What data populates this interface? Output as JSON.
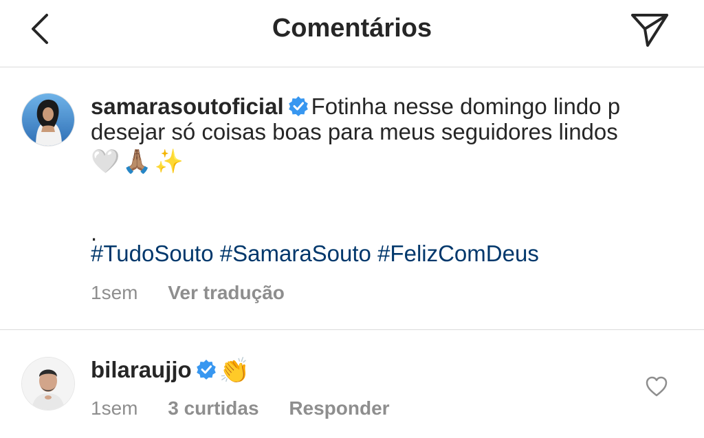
{
  "header": {
    "title": "Comentários",
    "back_icon": "chevron-left-icon",
    "send_icon": "paper-plane-icon"
  },
  "caption": {
    "username": "samarasoutoficial",
    "verified_icon": "verified-badge-icon",
    "text": "Fotinha nesse domingo lindo p desejar só coisas boas para meus seguidores lindos",
    "emojis": "🤍🙏🏽✨",
    "dot": ".",
    "hashtags": [
      "#TudoSouto",
      "#SamaraSouto",
      "#FelizComDeus"
    ],
    "time": "1sem",
    "translate_label": "Ver tradução"
  },
  "comment": {
    "username": "bilaraujjo",
    "verified_icon": "verified-badge-icon",
    "text": "👏",
    "time": "1sem",
    "likes": "3 curtidas",
    "reply_label": "Responder",
    "like_icon": "heart-outline-icon"
  },
  "colors": {
    "text": "#262626",
    "secondary": "#8e8e8e",
    "hashtag": "#00376b",
    "verified": "#3897f0",
    "divider": "#dbdbdb"
  }
}
